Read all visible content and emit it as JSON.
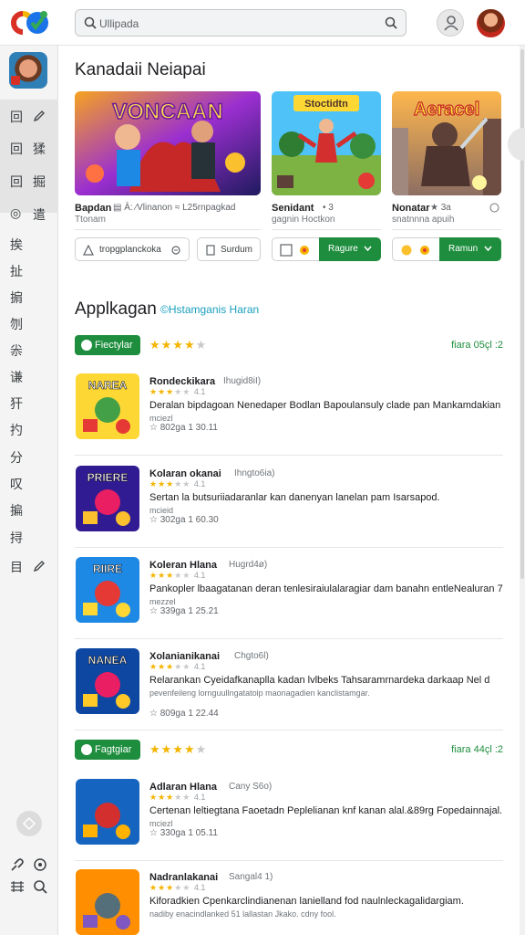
{
  "topbar": {
    "search_placeholder": "Ullipada"
  },
  "sidebar": {
    "items": [
      {
        "glyph": "回",
        "extra": "pencil-icon",
        "text": ""
      },
      {
        "glyph": "回",
        "text": "猱"
      },
      {
        "glyph": "回",
        "text": "掘"
      },
      {
        "glyph": "◎",
        "text": "遣"
      },
      {
        "glyph": "挨",
        "text": ""
      },
      {
        "glyph": "扯",
        "text": ""
      },
      {
        "glyph": "掮",
        "text": ""
      },
      {
        "glyph": "刎",
        "text": ""
      },
      {
        "glyph": "尜",
        "text": ""
      },
      {
        "glyph": "谦",
        "text": ""
      },
      {
        "glyph": "犴",
        "text": ""
      },
      {
        "glyph": "扚",
        "text": ""
      },
      {
        "glyph": "分",
        "text": ""
      },
      {
        "glyph": "叹",
        "text": ""
      },
      {
        "glyph": "揙",
        "text": ""
      },
      {
        "glyph": "挦",
        "text": ""
      },
      {
        "glyph": "目",
        "extra": "pencil-icon",
        "text": ""
      }
    ]
  },
  "featured": {
    "heading": "Kanadaii Neiapai",
    "cards": [
      {
        "title": "Bapdan",
        "meta": "▤ Ā: ⁄Vlinanon ≈ L25rnpagkad",
        "sub": "Ttonam",
        "art_text": "VONCAAN",
        "action": "tropgplanckoka",
        "action2": "Surdum"
      },
      {
        "title": "Senidant",
        "meta": "• 3",
        "sub": "gagnin Hoctkon",
        "art_text": "Stoctidtn",
        "action_btn": "Ragure"
      },
      {
        "title": "Nonatar",
        "meta": "★ 3a",
        "sub": "snatnnna apuih",
        "art_text": "Aeracel",
        "action_btn": "Ramun"
      }
    ]
  },
  "apps_section": {
    "title": "Applkagan",
    "subtitle": "©Hstamganis Haran",
    "groups": [
      {
        "badge": "Fiectylar",
        "rating": 4,
        "right_text": "fiara 05çl :2",
        "apps": [
          {
            "name": "Rondeckikara",
            "tag": "Ihugid8iI)",
            "desc": "Deralan bipdagoan Nenedaper Bodlan Bapoulansuly clade pan Mankamdakian",
            "desc2": "mciezl",
            "meta": "☆ 802ga   1 30.11",
            "icon_text": "NAREA"
          },
          {
            "name": "Kolaran okanai",
            "tag": "Ihngto6ia)",
            "desc": "Sertan la butsuriiadaranlar kan danenyan lanelan pam Isarsapod.",
            "desc2": "mcieid",
            "meta": "☆ 302ga   1 60.30",
            "icon_text": "PRIERE"
          },
          {
            "name": "Koleran Hlana",
            "tag": "Hugrd4ø)",
            "desc": "Pankopler lbaagatanan deran tenlesiraiulalaragiar dam banahn entleNealuran 7",
            "desc2": "mezzel",
            "meta": "☆ 339ga   1 25.21",
            "icon_text": "RIIRE"
          },
          {
            "name": "Xolanianikanai",
            "tag": "Chgto6l)",
            "desc": "Relarankan Cyeidafkanaplla kadan lvlbeks Tahsaramrnardeka darkaap Nel d",
            "desc2": "pevenfeileng lornguullngatatoip maonagadien kanclistamgar.",
            "meta": "☆ 809ga   1 22.44",
            "icon_text": "NANEA"
          }
        ]
      },
      {
        "badge": "Fagtgiar",
        "rating": 4,
        "right_text": "fiara 44çl :2",
        "apps": [
          {
            "name": "Adlaran Hlana",
            "tag": "Cany S6o)",
            "desc": "Certenan leltiegtana Faoetadn Peplelianan knf kanan alal.&89rg Fopedainnajal.",
            "desc2": "mciezl",
            "meta": "☆ 330ga   1 05.11",
            "icon_text": ""
          },
          {
            "name": "Nadranlakanai",
            "tag": "Sangal4 1)",
            "desc": "Kiforadkien Cpenkarclindianenan lanielland fod naulnleckagalidargiam.",
            "desc2": "nadiby enacindlanked 51 lallastan Jkako. cdny fool.",
            "meta": "",
            "icon_text": ""
          }
        ]
      }
    ]
  }
}
